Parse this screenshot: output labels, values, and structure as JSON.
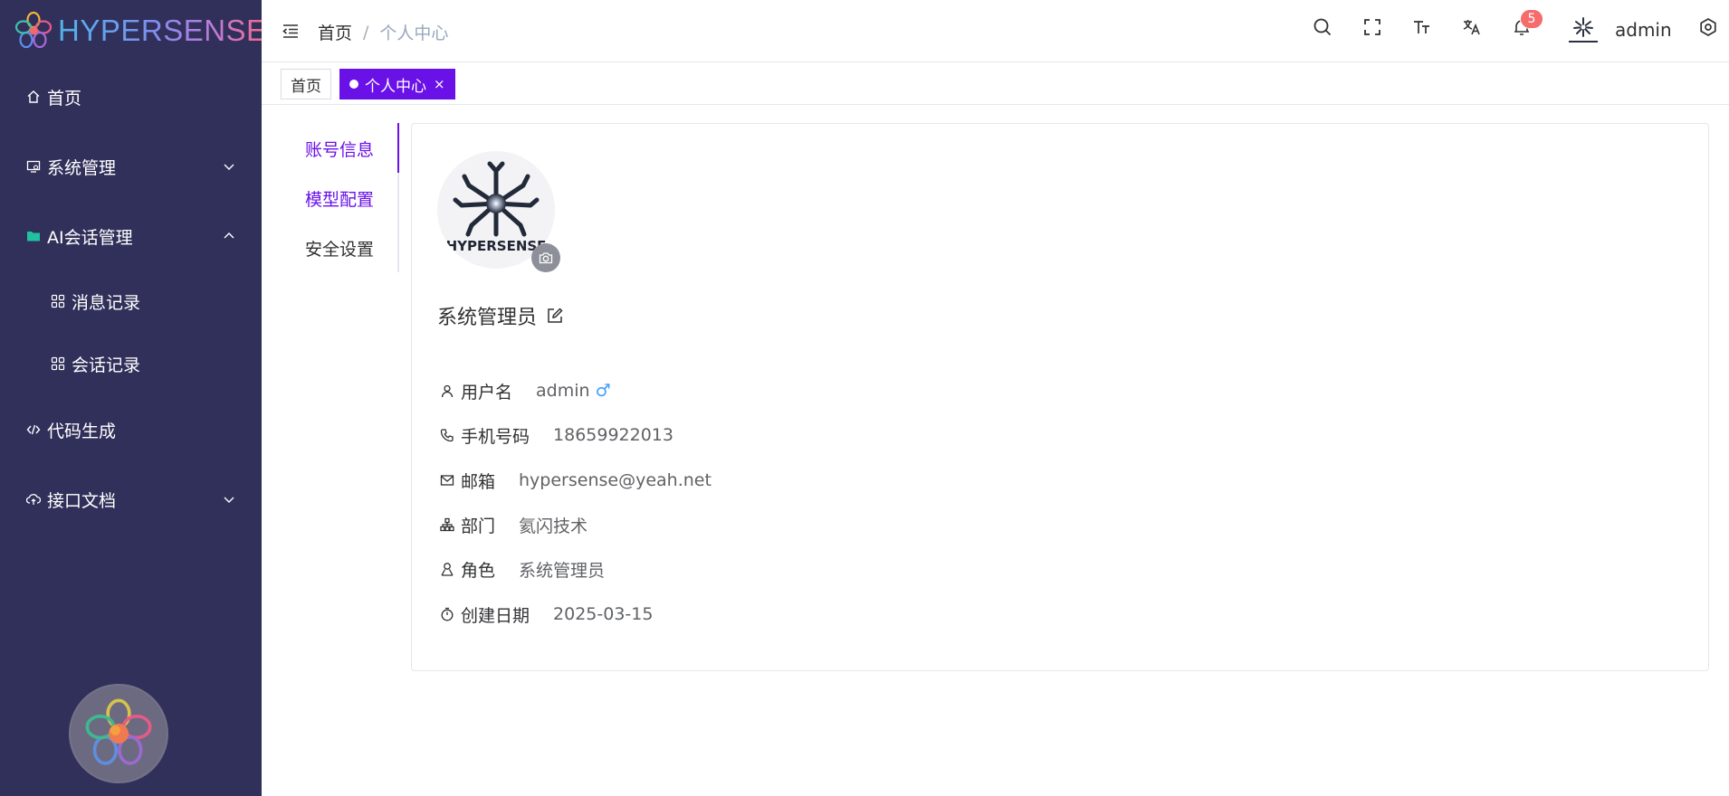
{
  "brand": {
    "name": "HYPERSENSE"
  },
  "sidebar": {
    "items": [
      {
        "label": "首页",
        "icon": "home-icon"
      },
      {
        "label": "系统管理",
        "icon": "monitor-icon",
        "expanded": false
      },
      {
        "label": "AI会话管理",
        "icon": "folder-icon",
        "expanded": true
      },
      {
        "label": "消息记录",
        "icon": "grid-icon"
      },
      {
        "label": "会话记录",
        "icon": "grid-icon"
      },
      {
        "label": "代码生成",
        "icon": "code-icon"
      },
      {
        "label": "接口文档",
        "icon": "cloud-icon",
        "expanded": false
      }
    ]
  },
  "navbar": {
    "breadcrumb": {
      "home": "首页",
      "separator": "/",
      "current": "个人中心"
    },
    "notification_count": "5",
    "user_name": "admin"
  },
  "tags": [
    {
      "label": "首页",
      "active": false
    },
    {
      "label": "个人中心",
      "active": true,
      "close": "×"
    }
  ],
  "profile_tabs": [
    {
      "label": "账号信息",
      "active": true
    },
    {
      "label": "模型配置",
      "active": false
    },
    {
      "label": "安全设置",
      "active": false
    }
  ],
  "profile": {
    "avatar_text": "HYPERSENSE",
    "nickname": "系统管理员",
    "fields": [
      {
        "label": "用户名",
        "value": "admin",
        "gender": "♂",
        "icon": "user-icon"
      },
      {
        "label": "手机号码",
        "value": "18659922013",
        "icon": "phone-icon"
      },
      {
        "label": "邮箱",
        "value": "hypersense@yeah.net",
        "icon": "mail-icon"
      },
      {
        "label": "部门",
        "value": "氦闪技术",
        "icon": "org-icon"
      },
      {
        "label": "角色",
        "value": "系统管理员",
        "icon": "role-icon"
      },
      {
        "label": "创建日期",
        "value": "2025-03-15",
        "icon": "timer-icon"
      }
    ]
  },
  "colors": {
    "sidebar_bg": "#31305a",
    "accent": "#6a11e8",
    "badge": "#f56c6c",
    "gender": "#409eff"
  }
}
